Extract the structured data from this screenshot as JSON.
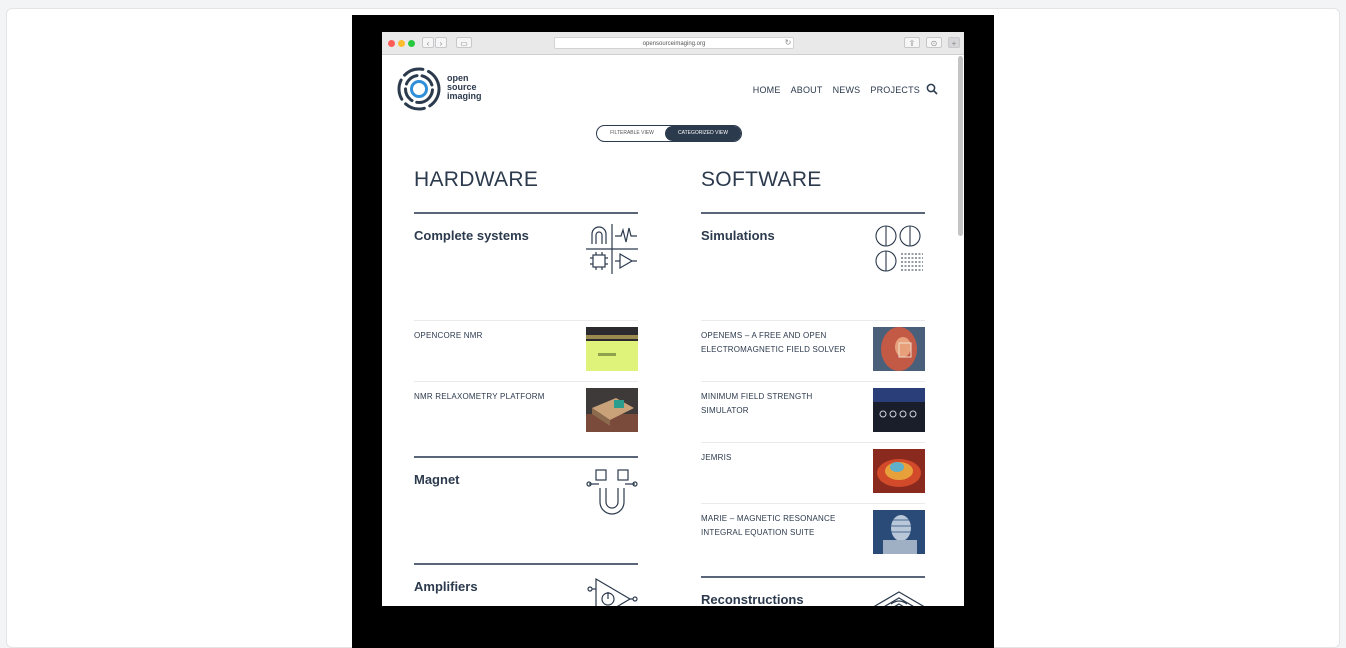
{
  "browser": {
    "url": "opensourceimaging.org"
  },
  "site": {
    "logo_lines": [
      "open",
      "source",
      "imaging"
    ],
    "nav": [
      "HOME",
      "ABOUT",
      "NEWS",
      "PROJECTS"
    ]
  },
  "view_toggle": {
    "options": [
      "FILTERABLE VIEW",
      "CATEGORIZED VIEW"
    ],
    "active": "CATEGORIZED VIEW"
  },
  "hardware": {
    "title": "HARDWARE",
    "categories": [
      {
        "name": "Complete systems",
        "items": [
          "OPENCORE NMR",
          "NMR RELAXOMETRY PLATFORM"
        ]
      },
      {
        "name": "Magnet",
        "items": []
      },
      {
        "name": "Amplifiers",
        "items": []
      }
    ]
  },
  "software": {
    "title": "SOFTWARE",
    "categories": [
      {
        "name": "Simulations",
        "items": [
          "OPENEMS – A FREE AND OPEN ELECTROMAGNETIC FIELD SOLVER",
          "MINIMUM FIELD STRENGTH SIMULATOR",
          "JEMRIS",
          "MARIE – MAGNETIC RESONANCE INTEGRAL EQUATION SUITE"
        ]
      },
      {
        "name": "Reconstructions",
        "items": []
      }
    ]
  },
  "colors": {
    "brand_dark": "#2c3a4d",
    "accent_blue": "#2f8fd8",
    "frame": "#000000"
  }
}
